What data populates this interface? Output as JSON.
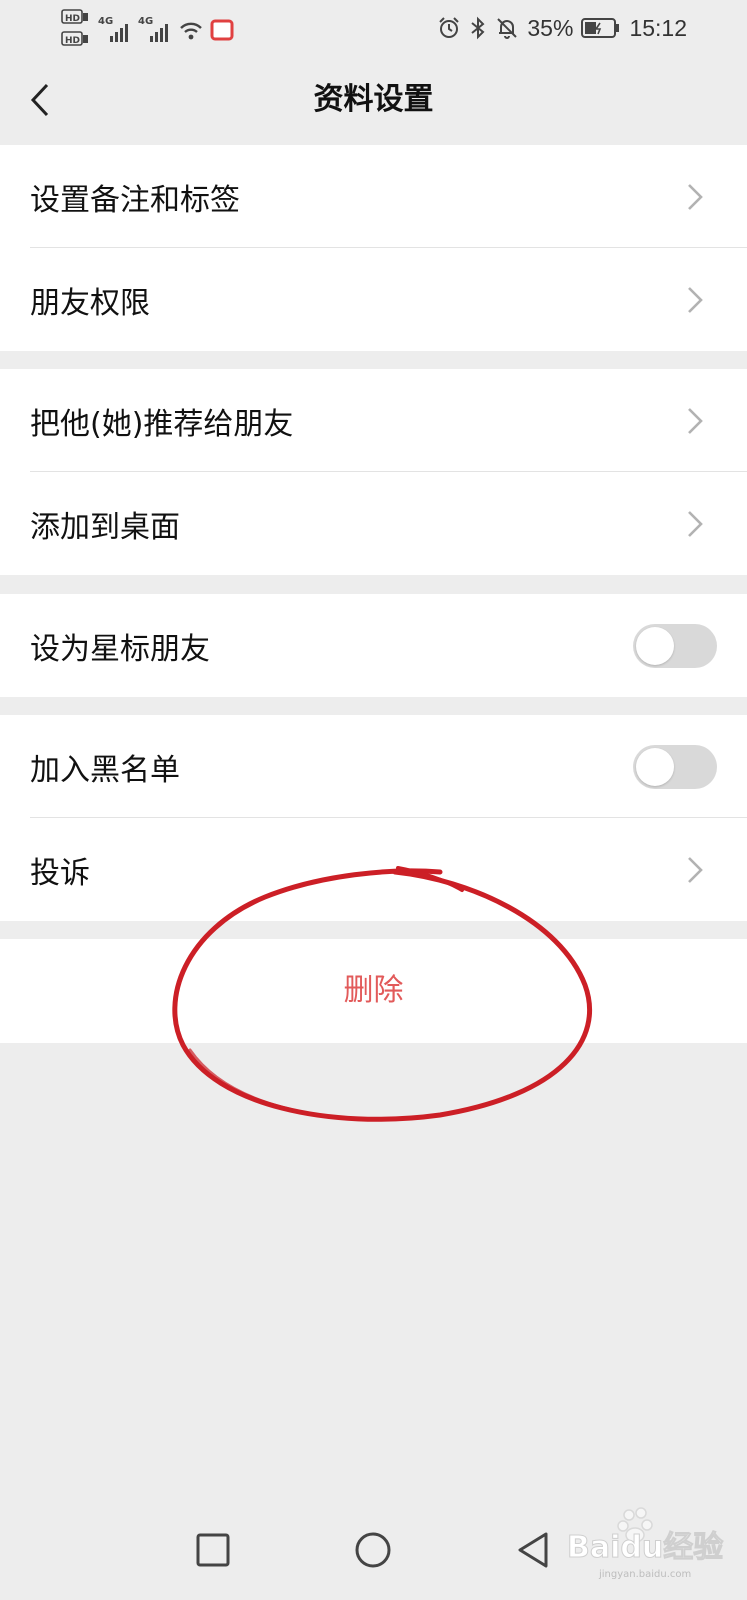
{
  "status_bar": {
    "left_icons": [
      "hd1-icon",
      "4g-signal-icon",
      "4g-signal-icon",
      "wifi-icon",
      "notification-icon"
    ],
    "network_label_1": "4G",
    "network_label_2": "4G",
    "battery_percent": "35%",
    "time": "15:12"
  },
  "header": {
    "title": "资料设置"
  },
  "groups": [
    {
      "items": [
        {
          "label": "设置备注和标签",
          "type": "chevron"
        },
        {
          "label": "朋友权限",
          "type": "chevron"
        }
      ]
    },
    {
      "items": [
        {
          "label": "把他(她)推荐给朋友",
          "type": "chevron"
        },
        {
          "label": "添加到桌面",
          "type": "chevron"
        }
      ]
    },
    {
      "items": [
        {
          "label": "设为星标朋友",
          "type": "toggle",
          "on": false
        }
      ]
    },
    {
      "items": [
        {
          "label": "加入黑名单",
          "type": "toggle",
          "on": false
        },
        {
          "label": "投诉",
          "type": "chevron"
        }
      ]
    }
  ],
  "delete": {
    "label": "删除",
    "color": "#e25a5a"
  },
  "annotation": {
    "color": "#cc1f26"
  },
  "system_nav": {
    "icons": [
      "recent-apps-icon",
      "home-icon",
      "back-icon"
    ]
  },
  "watermark": {
    "text": "Baidu经验",
    "subtext": "jingyan.baidu.com"
  }
}
